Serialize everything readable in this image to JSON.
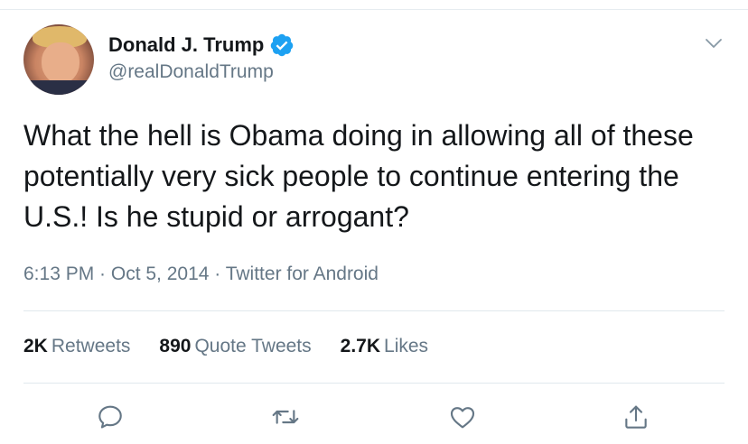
{
  "user": {
    "display_name": "Donald J. Trump",
    "handle": "@realDonaldTrump",
    "verified": true
  },
  "tweet": {
    "text": "What the hell is Obama doing in allowing all of these potentially very sick people to continue entering the U.S.! Is he stupid or arrogant?",
    "meta": "6:13 PM · Oct 5, 2014 · Twitter for Android"
  },
  "stats": [
    {
      "count": "2K",
      "label": "Retweets"
    },
    {
      "count": "890",
      "label": "Quote Tweets"
    },
    {
      "count": "2.7K",
      "label": "Likes"
    }
  ],
  "actions": [
    "reply-icon",
    "retweet-icon",
    "like-icon",
    "share-icon"
  ],
  "colors": {
    "text": "#14171a",
    "secondary": "#657786",
    "verified_blue": "#1da1f2",
    "divider": "#e1e8ed"
  }
}
